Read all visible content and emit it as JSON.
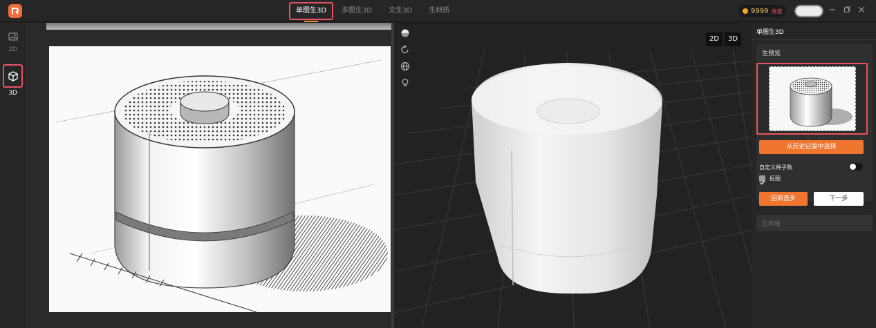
{
  "header": {
    "tabs": [
      {
        "label": "单图生3D",
        "active": true
      },
      {
        "label": "多图生3D",
        "active": false
      },
      {
        "label": "文生3D",
        "active": false
      },
      {
        "label": "生材质",
        "active": false
      }
    ],
    "coins": "9999",
    "recharge_label": "充值",
    "window_controls": [
      "minimize-icon",
      "restore-icon",
      "close-icon"
    ]
  },
  "rail": {
    "items": [
      {
        "label": "2D",
        "icon": "image-icon",
        "active": false
      },
      {
        "label": "3D",
        "icon": "cube-icon",
        "active": true
      }
    ]
  },
  "viewport": {
    "tools": [
      "sphere-shading-icon",
      "rotate-icon",
      "globe-icon",
      "light-bulb-icon"
    ],
    "view_buttons": [
      "2D",
      "3D"
    ]
  },
  "panel": {
    "title": "单图生3D",
    "preview_section": "生预览",
    "choose_history_label": "从历史记录中选择",
    "seed_label": "自定义种子数",
    "seed_toggle_on": false,
    "matting_label": "抠图",
    "matting_checked": true,
    "back_label": "回到首步",
    "next_label": "下一步",
    "mesh_section": "生网格"
  },
  "colors": {
    "accent": "#f0762f",
    "highlight_border": "#e9535f",
    "background": "#1e1e1e"
  }
}
